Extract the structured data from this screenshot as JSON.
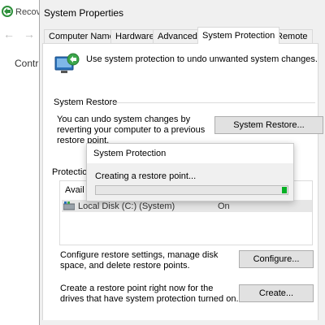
{
  "background_window": {
    "title": "Recov",
    "back_icon": "arrow-left-icon",
    "forward_icon": "arrow-right-icon",
    "nav_label": "Contr"
  },
  "dialog": {
    "title": "System Properties",
    "tabs": [
      {
        "label": "Computer Name",
        "active": false
      },
      {
        "label": "Hardware",
        "active": false
      },
      {
        "label": "Advanced",
        "active": false
      },
      {
        "label": "System Protection",
        "active": true
      },
      {
        "label": "Remote",
        "active": false
      }
    ],
    "intro": "Use system protection to undo unwanted system changes.",
    "restore_group": {
      "label": "System Restore",
      "description": "You can undo system changes by reverting your computer to a previous restore point.",
      "button": "System Restore..."
    },
    "protection_group": {
      "label": "Protectio",
      "available_label": "Avail",
      "drives": [
        {
          "name": "Local Disk (C:) (System)",
          "status": "On"
        }
      ]
    },
    "configure": {
      "text": "Configure restore settings, manage disk space, and delete restore points.",
      "button": "Configure..."
    },
    "create": {
      "text": "Create a restore point right now for the drives that have system protection turned on.",
      "button": "Create..."
    }
  },
  "modal": {
    "title": "System Protection",
    "message": "Creating a restore point...",
    "progress_fraction": 0.03,
    "progress_color": "#06b025"
  }
}
